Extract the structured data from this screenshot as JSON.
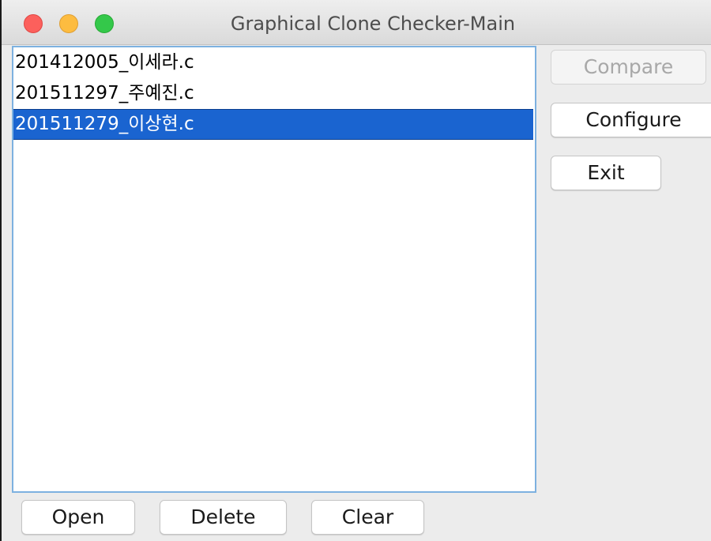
{
  "window": {
    "title": "Graphical Clone Checker-Main",
    "controls": [
      "close",
      "minimize",
      "zoom"
    ]
  },
  "files": [
    {
      "name": "201412005_이세라.c",
      "selected": false
    },
    {
      "name": "201511297_주예진.c",
      "selected": false
    },
    {
      "name": "201511279_이상현.c",
      "selected": true
    }
  ],
  "side_buttons": {
    "compare": {
      "label": "Compare",
      "enabled": false
    },
    "configure": {
      "label": "Configure",
      "enabled": true
    },
    "exit": {
      "label": "Exit",
      "enabled": true
    }
  },
  "bottom_buttons": {
    "open": "Open",
    "delete": "Delete",
    "clear": "Clear"
  },
  "colors": {
    "selection": "#1a64d0",
    "list_border": "#7db1e0",
    "traffic_close": "#fc605c",
    "traffic_minimize": "#fdbc40",
    "traffic_zoom": "#34c84a"
  }
}
